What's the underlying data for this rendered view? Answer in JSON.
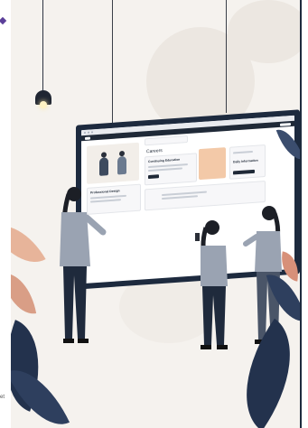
{
  "scene": {
    "caption_fragment": "et",
    "screen": {
      "header_title": "Careers",
      "card_title": "Continuing Education",
      "panel_title": "Professional Design",
      "side_title": "Daily Information"
    }
  },
  "colors": {
    "background": "#f5f2ee",
    "monitor": "#1d2a3e",
    "accent": "#f3c9a8",
    "shirt": "#9aa3b2",
    "pants": "#1f2a3c",
    "foliage": "#23324d"
  }
}
